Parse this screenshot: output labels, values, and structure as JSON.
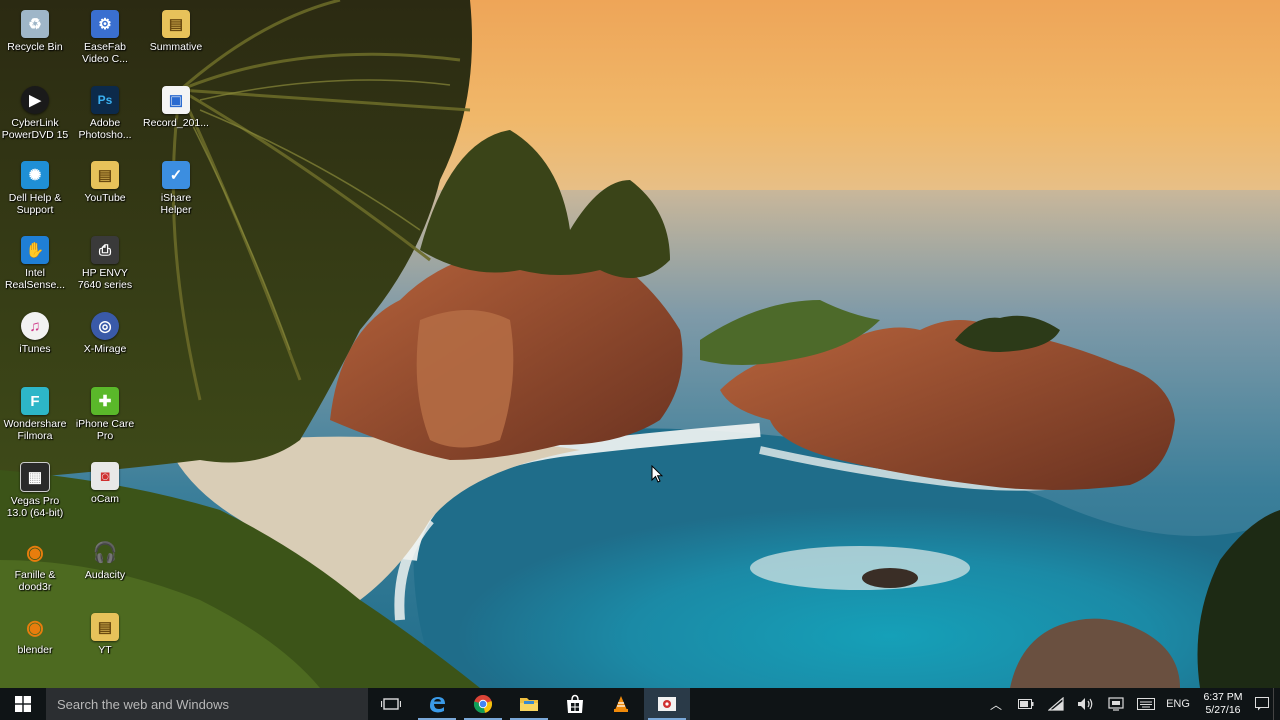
{
  "desktop": {
    "icons": [
      {
        "label": "Recycle Bin",
        "icon": "recycle-bin-icon",
        "color": "#9fb6c8"
      },
      {
        "label": "CyberLink\nPowerDVD 15",
        "icon": "powerdvd-icon",
        "color": "#1a1a1a"
      },
      {
        "label": "Dell Help &\nSupport",
        "icon": "dell-help-icon",
        "color": "#1f8fd6"
      },
      {
        "label": "Intel\nRealSense...",
        "icon": "intel-realsense-icon",
        "color": "#1f7fd6"
      },
      {
        "label": "iTunes",
        "icon": "itunes-icon",
        "color": "#f2f2f2"
      },
      {
        "label": "Wondershare\nFilmora",
        "icon": "filmora-icon",
        "color": "#2db6c8"
      },
      {
        "label": "Vegas Pro\n13.0 (64-bit)",
        "icon": "vegas-pro-icon",
        "color": "#2a2a2a"
      },
      {
        "label": "Fanille &\ndood3r",
        "icon": "blender-fanille-icon",
        "color": "#e87d0d"
      },
      {
        "label": "blender",
        "icon": "blender-icon",
        "color": "#e87d0d"
      },
      {
        "label": "EaseFab\nVideo C...",
        "icon": "easefab-icon",
        "color": "#3a6fd0"
      },
      {
        "label": "Adobe\nPhotosho...",
        "icon": "photoshop-icon",
        "color": "#0c2a4a"
      },
      {
        "label": "YouTube",
        "icon": "youtube-folder-icon",
        "color": "#e7c25a"
      },
      {
        "label": "HP ENVY\n7640 series",
        "icon": "hp-printer-icon",
        "color": "#3a3a3a"
      },
      {
        "label": "X-Mirage",
        "icon": "x-mirage-icon",
        "color": "#3a5aa8"
      },
      {
        "label": "iPhone Care\nPro",
        "icon": "iphone-care-icon",
        "color": "#5ab82a"
      },
      {
        "label": "oCam",
        "icon": "ocam-icon",
        "color": "#e8e8e8"
      },
      {
        "label": "Audacity",
        "icon": "audacity-icon",
        "color": "#f0a030"
      },
      {
        "label": "YT",
        "icon": "yt-folder-icon",
        "color": "#e7c25a"
      },
      {
        "label": "Summative",
        "icon": "summative-folder-icon",
        "color": "#e7c25a"
      },
      {
        "label": "Record_201...",
        "icon": "record-file-icon",
        "color": "#f4f4f4"
      },
      {
        "label": "iShare\nHelper",
        "icon": "ishare-helper-icon",
        "color": "#3c8ee0"
      }
    ]
  },
  "taskbar": {
    "search_placeholder": "Search the web and Windows",
    "apps": [
      {
        "name": "task-view",
        "icon": "task-view-icon"
      },
      {
        "name": "edge",
        "icon": "edge-icon"
      },
      {
        "name": "chrome",
        "icon": "chrome-icon"
      },
      {
        "name": "file-explorer",
        "icon": "file-explorer-icon"
      },
      {
        "name": "store",
        "icon": "store-icon"
      },
      {
        "name": "vlc",
        "icon": "vlc-icon"
      },
      {
        "name": "ocam",
        "icon": "ocam-taskbar-icon"
      }
    ],
    "tray": {
      "language": "ENG",
      "time": "6:37 PM",
      "date": "5/27/16"
    }
  },
  "colors": {
    "taskbar_bg": "#0f1416",
    "search_bg": "#2b2e31",
    "accent": "#7aa8d8"
  }
}
